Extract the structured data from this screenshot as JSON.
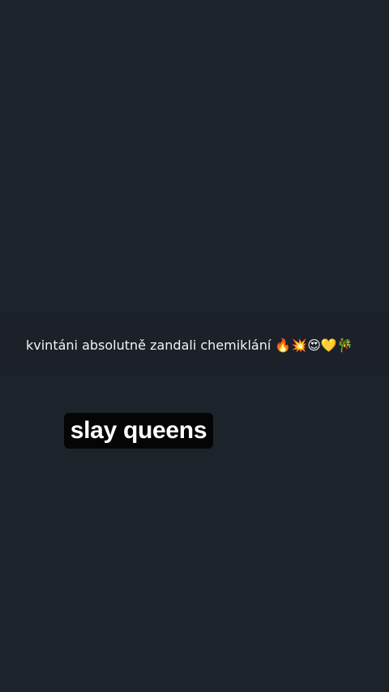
{
  "background_color": "#1d232b",
  "caption": {
    "text": "kvintáni absolutně zandali chemiklání 🔥💥😍💛🎋"
  },
  "sticker": {
    "text": "slay queens",
    "background_color": "#050505",
    "text_color": "#ffffff"
  }
}
